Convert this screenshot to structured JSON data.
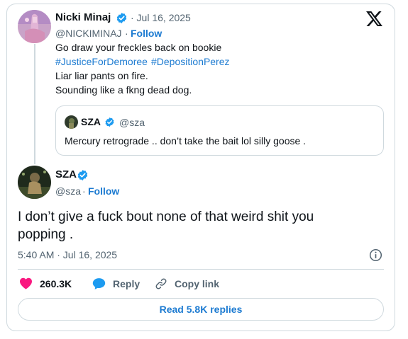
{
  "main_tweet": {
    "author_name": "SZA",
    "handle": "@sza",
    "separator": "·",
    "follow_label": "Follow",
    "text_line1": "I don’t give a fuck bout none of that weird shit you",
    "text_line2": "popping .",
    "timestamp": "5:40 AM · Jul 16, 2025"
  },
  "quoted_parent": {
    "author_name": "Nicki Minaj",
    "date": "· Jul 16, 2025",
    "handle": "@NICKIMINAJ",
    "separator": "·",
    "follow_label": "Follow",
    "line1": "Go draw your freckles back on bookie",
    "hashtag1": "#JusticeForDemoree",
    "hashtag2": "#DepositionPerez",
    "line3": "Liar liar pants on fire.",
    "line4": "Sounding like a fkng dead dog."
  },
  "nested_quote": {
    "author_name": "SZA",
    "handle": "@sza",
    "text": "Mercury retrograde .. don’t take the bait lol silly goose ."
  },
  "actions": {
    "likes": "260.3K",
    "reply_label": "Reply",
    "copy_link_label": "Copy link"
  },
  "read_replies_label": "Read 5.8K replies",
  "colors": {
    "like": "#f91880",
    "reply": "#1d9bf0",
    "verified": "#1d9bf0",
    "link": "#1d7bd1",
    "muted": "#536471",
    "border": "#cfd9de"
  },
  "icons": [
    "x-logo-icon",
    "verified-badge-icon",
    "heart-icon",
    "reply-bubble-icon",
    "link-icon",
    "info-icon"
  ]
}
